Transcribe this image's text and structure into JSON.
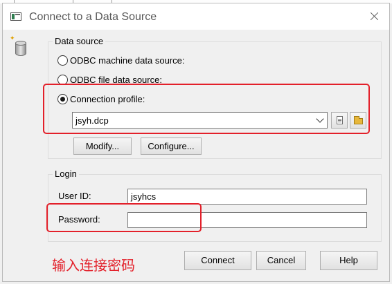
{
  "window": {
    "title": "Connect to a Data Source"
  },
  "data_source": {
    "legend": "Data source",
    "options": [
      {
        "label": "ODBC machine data source:",
        "checked": false
      },
      {
        "label": "ODBC file data source:",
        "checked": false
      },
      {
        "label": "Connection profile:",
        "checked": true
      }
    ],
    "profile_value": "jsyh.dcp",
    "modify_label": "Modify...",
    "configure_label": "Configure..."
  },
  "login": {
    "legend": "Login",
    "user_id_label": "User ID:",
    "user_id_value": "jsyhcs",
    "password_label": "Password:",
    "password_value": ""
  },
  "buttons": {
    "connect": "Connect",
    "cancel": "Cancel",
    "help": "Help"
  },
  "annotation": {
    "text": "输入连接密码",
    "color": "#e3202a"
  }
}
